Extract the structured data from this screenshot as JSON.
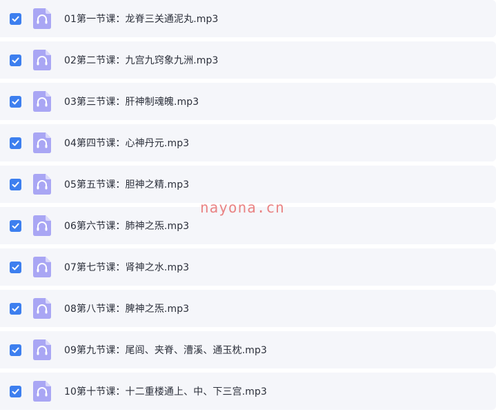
{
  "colors": {
    "checkbox": "#3d7fef",
    "file_icon": "#a9a6f4",
    "file_icon_fold": "#d9d7fb",
    "row_background": "#f5f6fa",
    "watermark": "#e87070"
  },
  "checkbox_icon": "checkmark-icon",
  "file_icon_name": "audio-file-headphones-icon",
  "files": [
    {
      "name": "01第一节课：龙脊三关通泥丸.mp3",
      "checked": true
    },
    {
      "name": "02第二节课：九宫九窍象九洲.mp3",
      "checked": true
    },
    {
      "name": "03第三节课：肝神制魂魄.mp3",
      "checked": true
    },
    {
      "name": "04第四节课：心神丹元.mp3",
      "checked": true
    },
    {
      "name": "05第五节课：胆神之精.mp3",
      "checked": true
    },
    {
      "name": "06第六节课：肺神之炁.mp3",
      "checked": true
    },
    {
      "name": "07第七节课：肾神之水.mp3",
      "checked": true
    },
    {
      "name": "08第八节课：脾神之炁.mp3",
      "checked": true
    },
    {
      "name": "09第九节课：尾闾、夹脊、漕溪、通玉枕.mp3",
      "checked": true
    },
    {
      "name": "10第十节课：十二重楼通上、中、下三宫.mp3",
      "checked": true
    }
  ],
  "watermark": "nayona.cn"
}
